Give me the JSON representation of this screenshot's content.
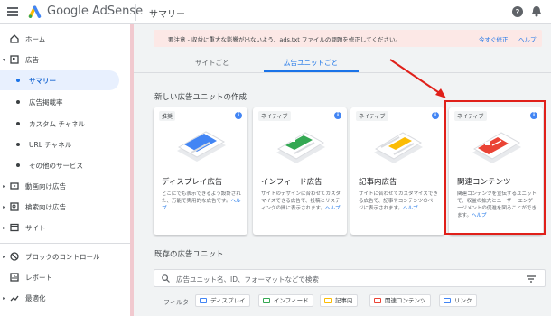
{
  "header": {
    "brand": "Google AdSense",
    "page_title": "サマリー"
  },
  "colors": {
    "accent": "#1a73e8",
    "highlight": "#e0201a",
    "notice_bg": "#fce8e6"
  },
  "sidebar": {
    "items": [
      {
        "label": "ホーム",
        "icon": "home-icon"
      },
      {
        "label": "広告",
        "icon": "ads-icon",
        "caret": "▾"
      },
      {
        "label": "サマリー",
        "active": true
      },
      {
        "label": "広告掲載率"
      },
      {
        "label": "カスタム チャネル"
      },
      {
        "label": "URL チャネル"
      },
      {
        "label": "その他のサービス"
      },
      {
        "label": "動画向け広告",
        "icon": "video-icon",
        "caret": "▸"
      },
      {
        "label": "検索向け広告",
        "icon": "search-ads-icon",
        "caret": "▸"
      },
      {
        "label": "サイト",
        "icon": "site-icon",
        "caret": "▸"
      },
      {
        "label": "ブロックのコントロール",
        "icon": "block-icon",
        "caret": "▸"
      },
      {
        "label": "レポート",
        "icon": "report-icon"
      },
      {
        "label": "最適化",
        "icon": "trend-icon",
        "caret": "▸"
      }
    ]
  },
  "notice": {
    "text": "要注意 - 収益に重大な影響が出ないよう、ads.txt ファイルの問題を修正してください。",
    "fix_label": "今すぐ修正",
    "help_label": "ヘルプ"
  },
  "tabs": [
    {
      "label": "サイトごと"
    },
    {
      "label": "広告ユニットごと",
      "active": true
    }
  ],
  "new_section_title": "新しい広告ユニットの作成",
  "cards": [
    {
      "badge": "推奨",
      "title": "ディスプレイ広告",
      "desc": "どこにでも表示できるよう設計された、万能で実用的な広告です。",
      "link": "ヘルプ",
      "color": "#4285f4"
    },
    {
      "badge": "ネイティブ",
      "title": "インフィード広告",
      "desc": "サイトのデザインに合わせてカスタマイズできる広告で、投稿とリスティングの間に表示されます。",
      "link": "ヘルプ",
      "color": "#34a853"
    },
    {
      "badge": "ネイティブ",
      "title": "記事内広告",
      "desc": "サイトに合わせてカスタマイズできる広告で、記事やコンテンツのページに表示されます。",
      "link": "ヘルプ",
      "color": "#fbbc04"
    },
    {
      "badge": "ネイティブ",
      "title": "関連コンテンツ",
      "desc": "関連コンテンツを宣伝するユニットで、収益の拡大とユーザー エンゲージメントの促進を図ることができます。",
      "link": "ヘルプ",
      "color": "#ea4335"
    }
  ],
  "existing_section_title": "既存の広告ユニット",
  "search": {
    "placeholder": "広告ユニット名、ID、フォーマットなどで検索"
  },
  "filter": {
    "label": "フィルタ",
    "chips": [
      {
        "label": "ディスプレイ",
        "color": "#4285f4"
      },
      {
        "label": "インフィード",
        "color": "#34a853"
      },
      {
        "label": "記事内",
        "color": "#fbbc04"
      },
      {
        "label": "関連コンテンツ",
        "color": "#ea4335"
      },
      {
        "label": "リンク",
        "color": "#4285f4"
      }
    ]
  }
}
